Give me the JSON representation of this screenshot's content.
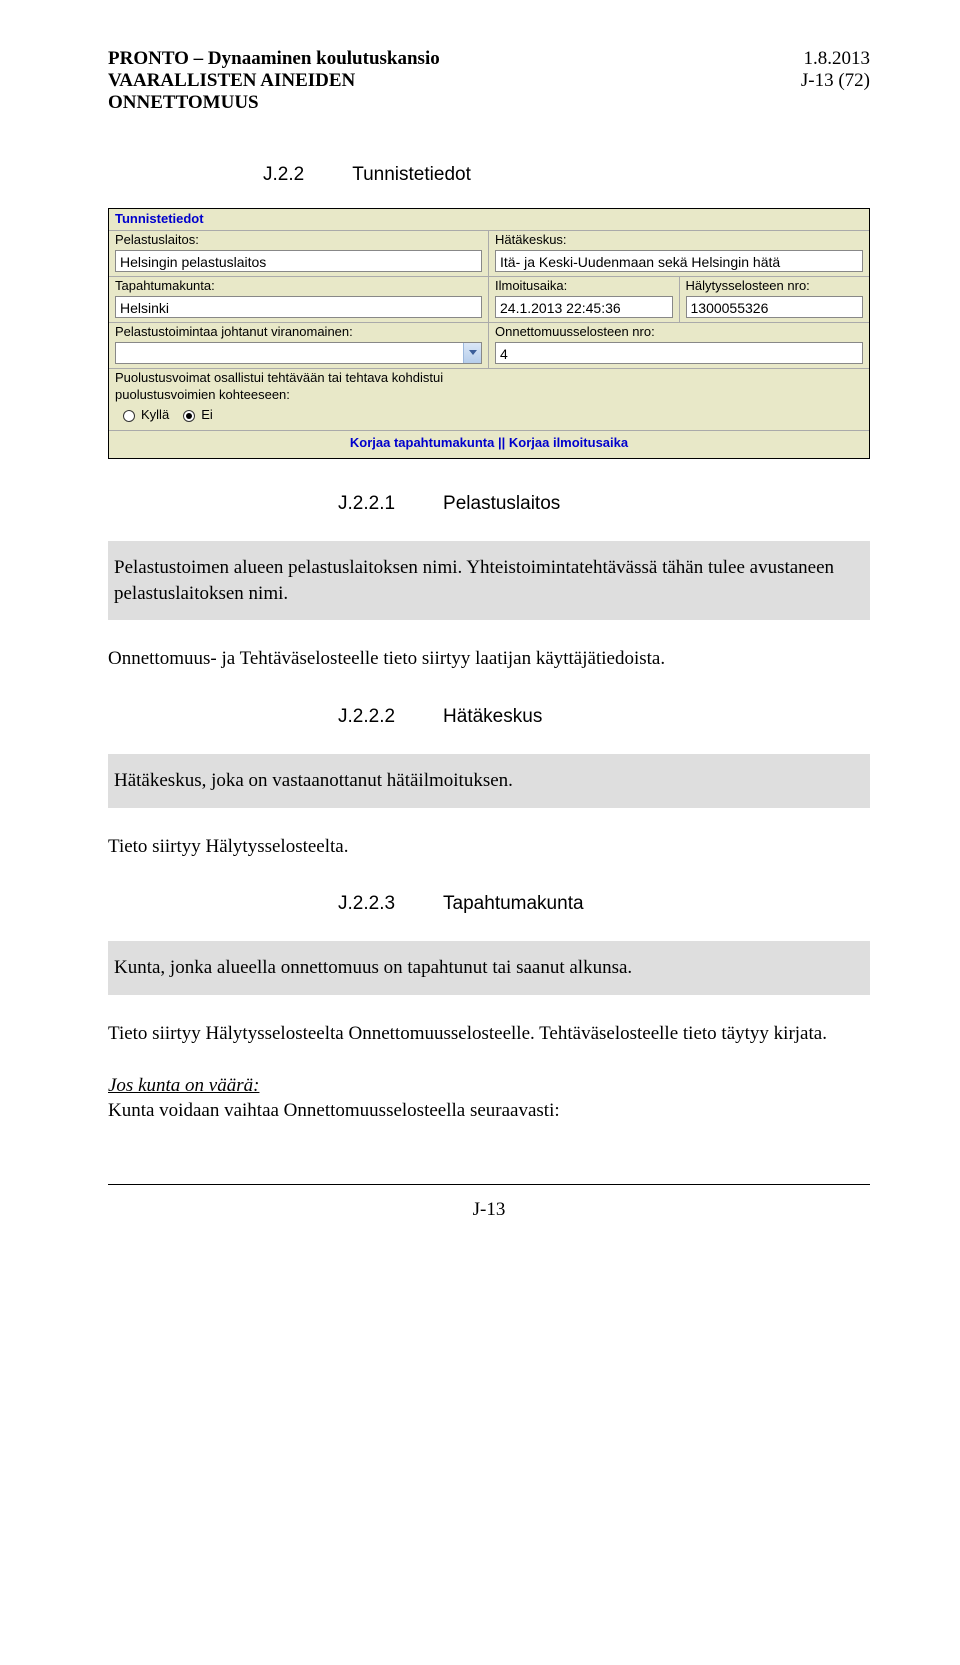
{
  "header": {
    "left_line1": "PRONTO – Dynaaminen koulutuskansio",
    "left_line2": "VAARALLISTEN AINEIDEN",
    "left_line3": "ONNETTOMUUS",
    "right_line1": "1.8.2013",
    "right_line2": "J-13 (72)"
  },
  "section": {
    "num": "J.2.2",
    "title": "Tunnistetiedot"
  },
  "form": {
    "title": "Tunnistetiedot",
    "pelastuslaitos_label": "Pelastuslaitos:",
    "pelastuslaitos_value": "Helsingin pelastuslaitos",
    "hatakeskus_label": "Hätäkeskus:",
    "hatakeskus_value": "Itä- ja Keski-Uudenmaan sekä Helsingin hätä",
    "tapahtumakunta_label": "Tapahtumakunta:",
    "tapahtumakunta_value": "Helsinki",
    "ilmoitusaika_label": "Ilmoitusaika:",
    "ilmoitusaika_value": "24.1.2013 22:45:36",
    "halytysselosteen_label": "Hälytysselosteen nro:",
    "halytysselosteen_value": "1300055326",
    "johtanut_label": "Pelastustoimintaa johtanut viranomainen:",
    "onnettomuus_label": "Onnettomuusselosteen nro:",
    "onnettomuus_value": "4",
    "puolustus_l1": "Puolustusvoimat osallistui tehtävään tai tehtava kohdistui",
    "puolustus_l2": "puolustusvoimien kohteeseen:",
    "radio_yes": "Kyllä",
    "radio_no": "Ei",
    "link1": "Korjaa tapahtumakunta",
    "linksep": "||",
    "link2": "Korjaa ilmoitusaika"
  },
  "sub1": {
    "num": "J.2.2.1",
    "title": "Pelastuslaitos",
    "note": "Pelastustoimen alueen pelastuslaitoksen nimi. Yhteistoimintatehtävässä tähän tulee avustaneen pelastuslaitoksen nimi.",
    "para": "Onnettomuus- ja Tehtäväselosteelle tieto siirtyy laatijan käyttäjätiedoista."
  },
  "sub2": {
    "num": "J.2.2.2",
    "title": "Hätäkeskus",
    "note": "Hätäkeskus, joka on vastaanottanut hätäilmoituksen.",
    "para": "Tieto siirtyy Hälytysselosteelta."
  },
  "sub3": {
    "num": "J.2.2.3",
    "title": "Tapahtumakunta",
    "note": "Kunta, jonka alueella onnettomuus on tapahtunut tai saanut alkunsa.",
    "para1": "Tieto siirtyy Hälytysselosteelta Onnettomuusselosteelle. Tehtäväselosteelle tieto täytyy kirjata.",
    "lead": "Jos kunta on väärä:",
    "para2": "Kunta voidaan vaihtaa Onnettomuusselosteella seuraavasti:"
  },
  "footer": {
    "pagenum": "J-13"
  }
}
